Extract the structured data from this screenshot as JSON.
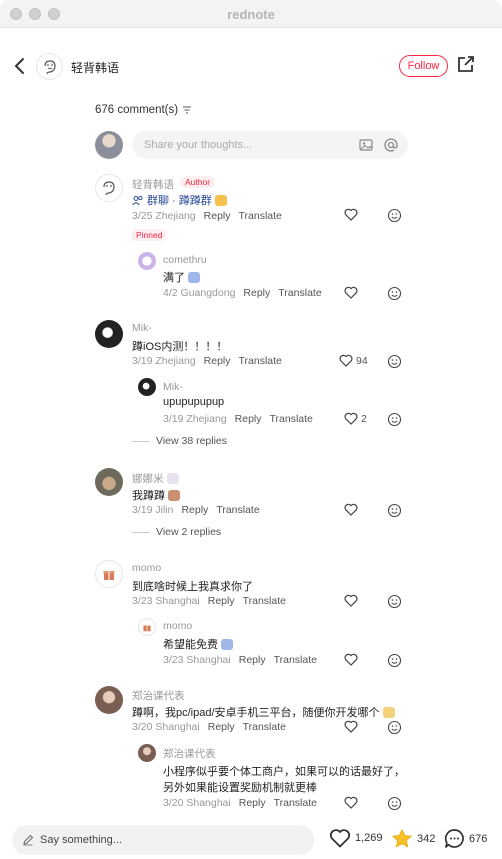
{
  "window": {
    "title": "rednote"
  },
  "header": {
    "name": "轻背韩语",
    "follow_label": "Follow"
  },
  "comments_header": {
    "count_label": "676 comment(s)"
  },
  "input": {
    "placeholder": "Share your thoughts..."
  },
  "comments": [
    {
      "name": "轻背韩语",
      "author_tag": "Author",
      "text": "群聊 · 蹲蹲群",
      "date": "3/25",
      "location": "Zhejiang",
      "reply": "Reply",
      "translate": "Translate",
      "pinned": "Pinned",
      "likes": ""
    },
    {
      "name": "comethru",
      "text": "满了",
      "date": "4/2",
      "location": "Guangdong",
      "reply": "Reply",
      "translate": "Translate",
      "likes": ""
    },
    {
      "name": "Mik-",
      "text": "蹲iOS内测！！！！",
      "date": "3/19",
      "location": "Zhejiang",
      "reply": "Reply",
      "translate": "Translate",
      "likes": "94"
    },
    {
      "name": "Mik-",
      "text": "upupupupup",
      "date": "3/19",
      "location": "Zhejiang",
      "reply": "Reply",
      "translate": "Translate",
      "likes": "2"
    },
    {
      "view_replies": "View 38 replies"
    },
    {
      "name": "娜娜米",
      "text": "我蹲蹲",
      "date": "3/19",
      "location": "Jilin",
      "reply": "Reply",
      "translate": "Translate",
      "likes": ""
    },
    {
      "view_replies": "View 2 replies"
    },
    {
      "name": "momo",
      "text": "到底啥时候上我真求你了",
      "date": "3/23",
      "location": "Shanghai",
      "reply": "Reply",
      "translate": "Translate",
      "likes": ""
    },
    {
      "name": "momo",
      "text": "希望能免费",
      "date": "3/23",
      "location": "Shanghai",
      "reply": "Reply",
      "translate": "Translate",
      "likes": ""
    },
    {
      "name": "郑治课代表",
      "text": "蹲啊，我pc/ipad/安卓手机三平台，随便你开发哪个",
      "date": "3/20",
      "location": "Shanghai",
      "reply": "Reply",
      "translate": "Translate",
      "likes": ""
    },
    {
      "name": "郑治课代表",
      "text": "小程序似乎要个体工商户，如果可以的话最好了，",
      "text2": "另外如果能设置奖励机制就更棒",
      "date": "3/20",
      "location": "Shanghai",
      "reply": "Reply",
      "translate": "Translate",
      "likes": ""
    }
  ],
  "bottom": {
    "say_placeholder": "Say something...",
    "likes": "1,269",
    "collects": "342",
    "comments": "676"
  },
  "colors": {
    "accent": "#ff2442",
    "star": "#f5c02a"
  }
}
